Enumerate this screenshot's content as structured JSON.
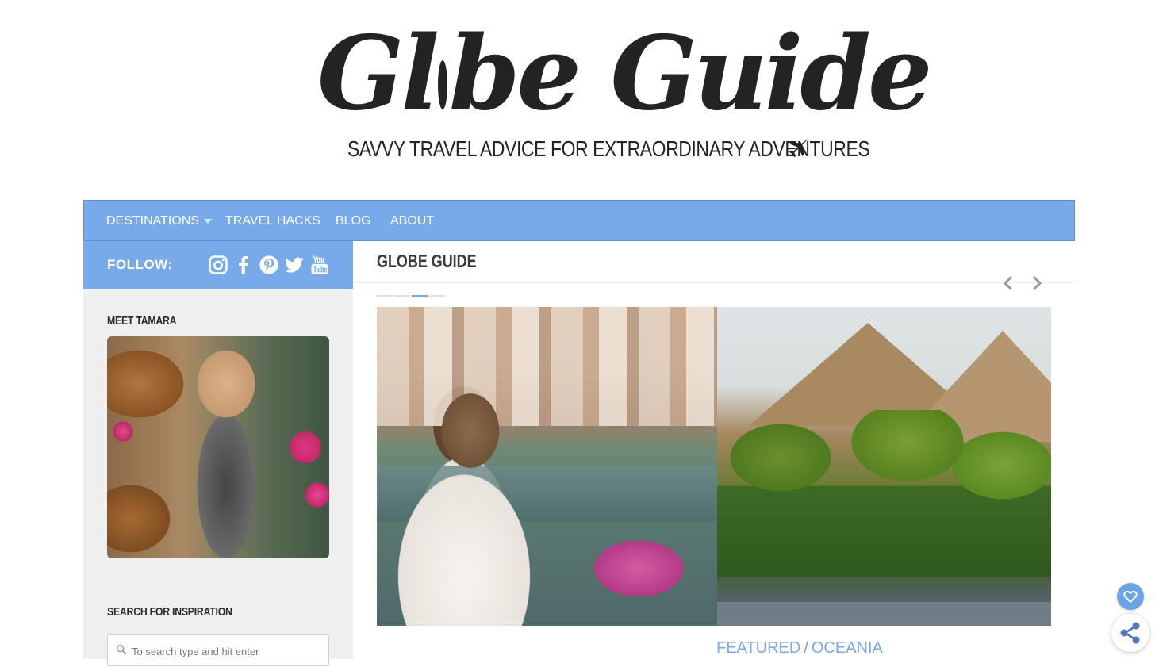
{
  "header": {
    "logo_title_part1": "Gl",
    "logo_title_part2": "be Guide",
    "tagline": "SAVVY TRAVEL ADVICE FOR EXTRAORDINARY ADVENTURES"
  },
  "nav": {
    "items": [
      {
        "label": "DESTINATIONS",
        "has_dropdown": true
      },
      {
        "label": "TRAVEL HACKS"
      },
      {
        "label": "BLOG"
      },
      {
        "label": "ABOUT"
      }
    ]
  },
  "sidebar": {
    "follow_label": "FOLLOW:",
    "social_icons": [
      "instagram-icon",
      "facebook-icon",
      "pinterest-icon",
      "twitter-icon",
      "youtube-icon"
    ],
    "meet_heading": "MEET TAMARA",
    "search_heading": "SEARCH FOR INSPIRATION",
    "search_placeholder": "To search type and hit enter"
  },
  "main": {
    "title": "GLOBE GUIDE",
    "carousel": {
      "slide_count": 4,
      "active_index": 2
    },
    "category": {
      "primary": "FEATURED",
      "separator": "/",
      "secondary": "OCEANIA"
    }
  },
  "colors": {
    "accent": "#78aaea",
    "sidebar_bg": "#efefef",
    "text_dark": "#232323"
  }
}
